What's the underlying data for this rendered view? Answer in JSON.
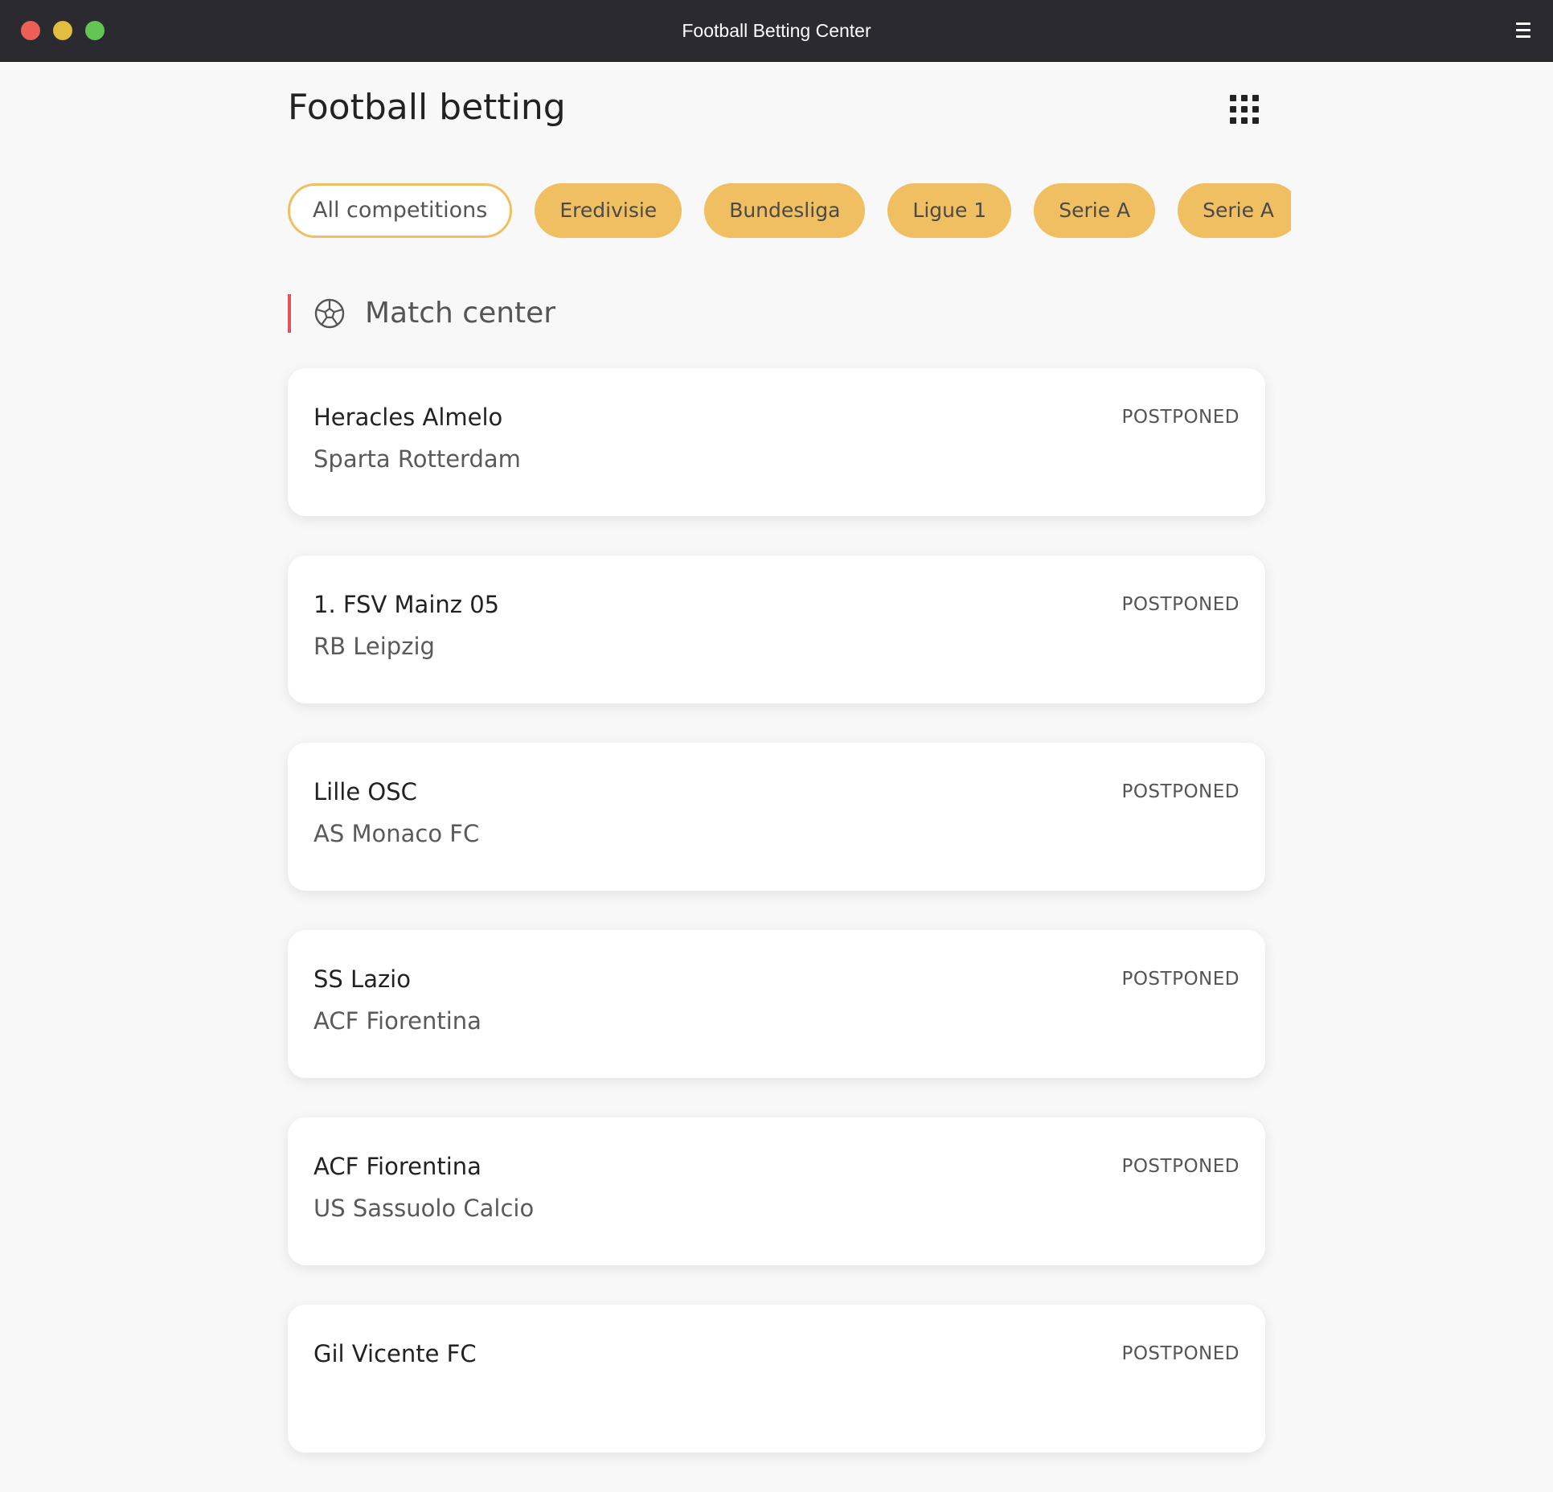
{
  "window": {
    "title": "Football Betting Center"
  },
  "header": {
    "title": "Football betting"
  },
  "competitions": [
    {
      "label": "All competitions",
      "active": true
    },
    {
      "label": "Eredivisie"
    },
    {
      "label": "Bundesliga"
    },
    {
      "label": "Ligue 1"
    },
    {
      "label": "Serie A"
    },
    {
      "label": "Serie A"
    },
    {
      "label": ""
    }
  ],
  "section": {
    "title": "Match center",
    "icon": "soccer-ball-icon"
  },
  "matches": [
    {
      "home": "Heracles Almelo",
      "away": "Sparta Rotterdam",
      "status": "POSTPONED"
    },
    {
      "home": "1. FSV Mainz 05",
      "away": "RB Leipzig",
      "status": "POSTPONED"
    },
    {
      "home": "Lille OSC",
      "away": "AS Monaco FC",
      "status": "POSTPONED"
    },
    {
      "home": "SS Lazio",
      "away": "ACF Fiorentina",
      "status": "POSTPONED"
    },
    {
      "home": "ACF Fiorentina",
      "away": "US Sassuolo Calcio",
      "status": "POSTPONED"
    },
    {
      "home": "Gil Vicente FC",
      "away": "",
      "status": "POSTPONED"
    }
  ],
  "colors": {
    "titlebar": "#2b2a30",
    "chip": "#efbf62",
    "accent_bar": "#e0535f",
    "background": "#f8f8f8"
  }
}
